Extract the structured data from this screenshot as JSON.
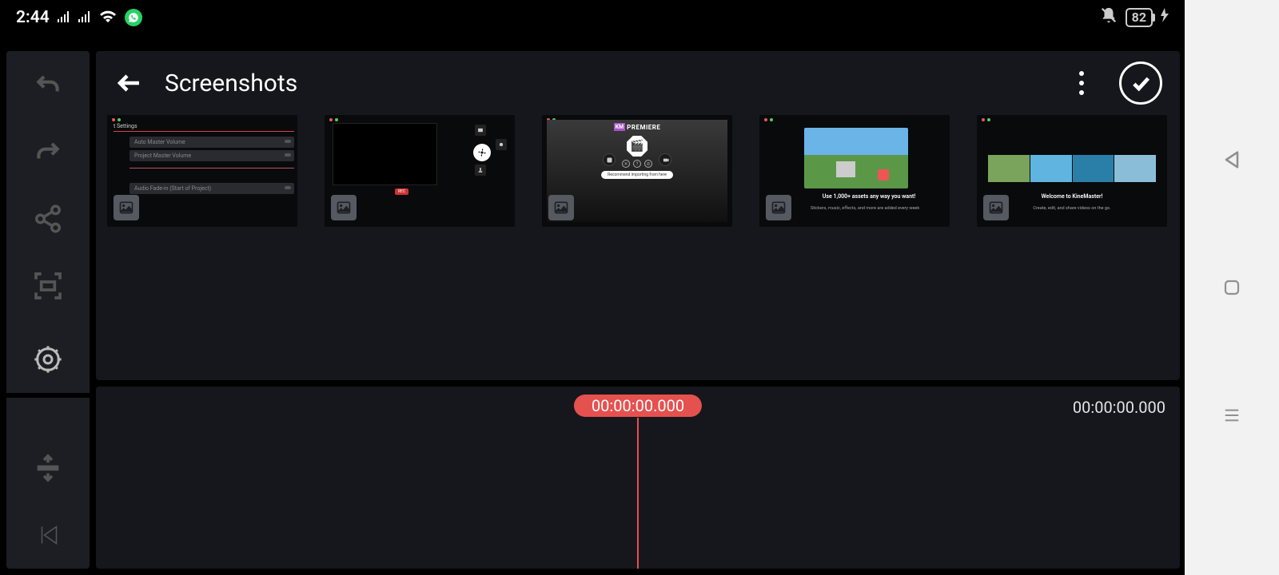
{
  "status": {
    "time": "2:44",
    "battery": "82"
  },
  "panel": {
    "title": "Screenshots"
  },
  "thumbs": {
    "t1": {
      "r1": "Auto Master Volume",
      "r2": "Project Master Volume",
      "r3": "Audio Fade-in (Start of Project)"
    },
    "t3": {
      "km": "KM",
      "premiere": "PREMIERE",
      "pill": "Recommend importing from here"
    },
    "t4": {
      "line1": "Use 1,000+ assets any way you want!",
      "line2": "Stickers, music, effects, and more are added every week"
    },
    "t5": {
      "heading": "Welcome to KineMaster!",
      "sub": "Create, edit, and share videos on the go."
    }
  },
  "timeline": {
    "playhead": "00:00:00.000",
    "duration": "00:00:00.000"
  }
}
